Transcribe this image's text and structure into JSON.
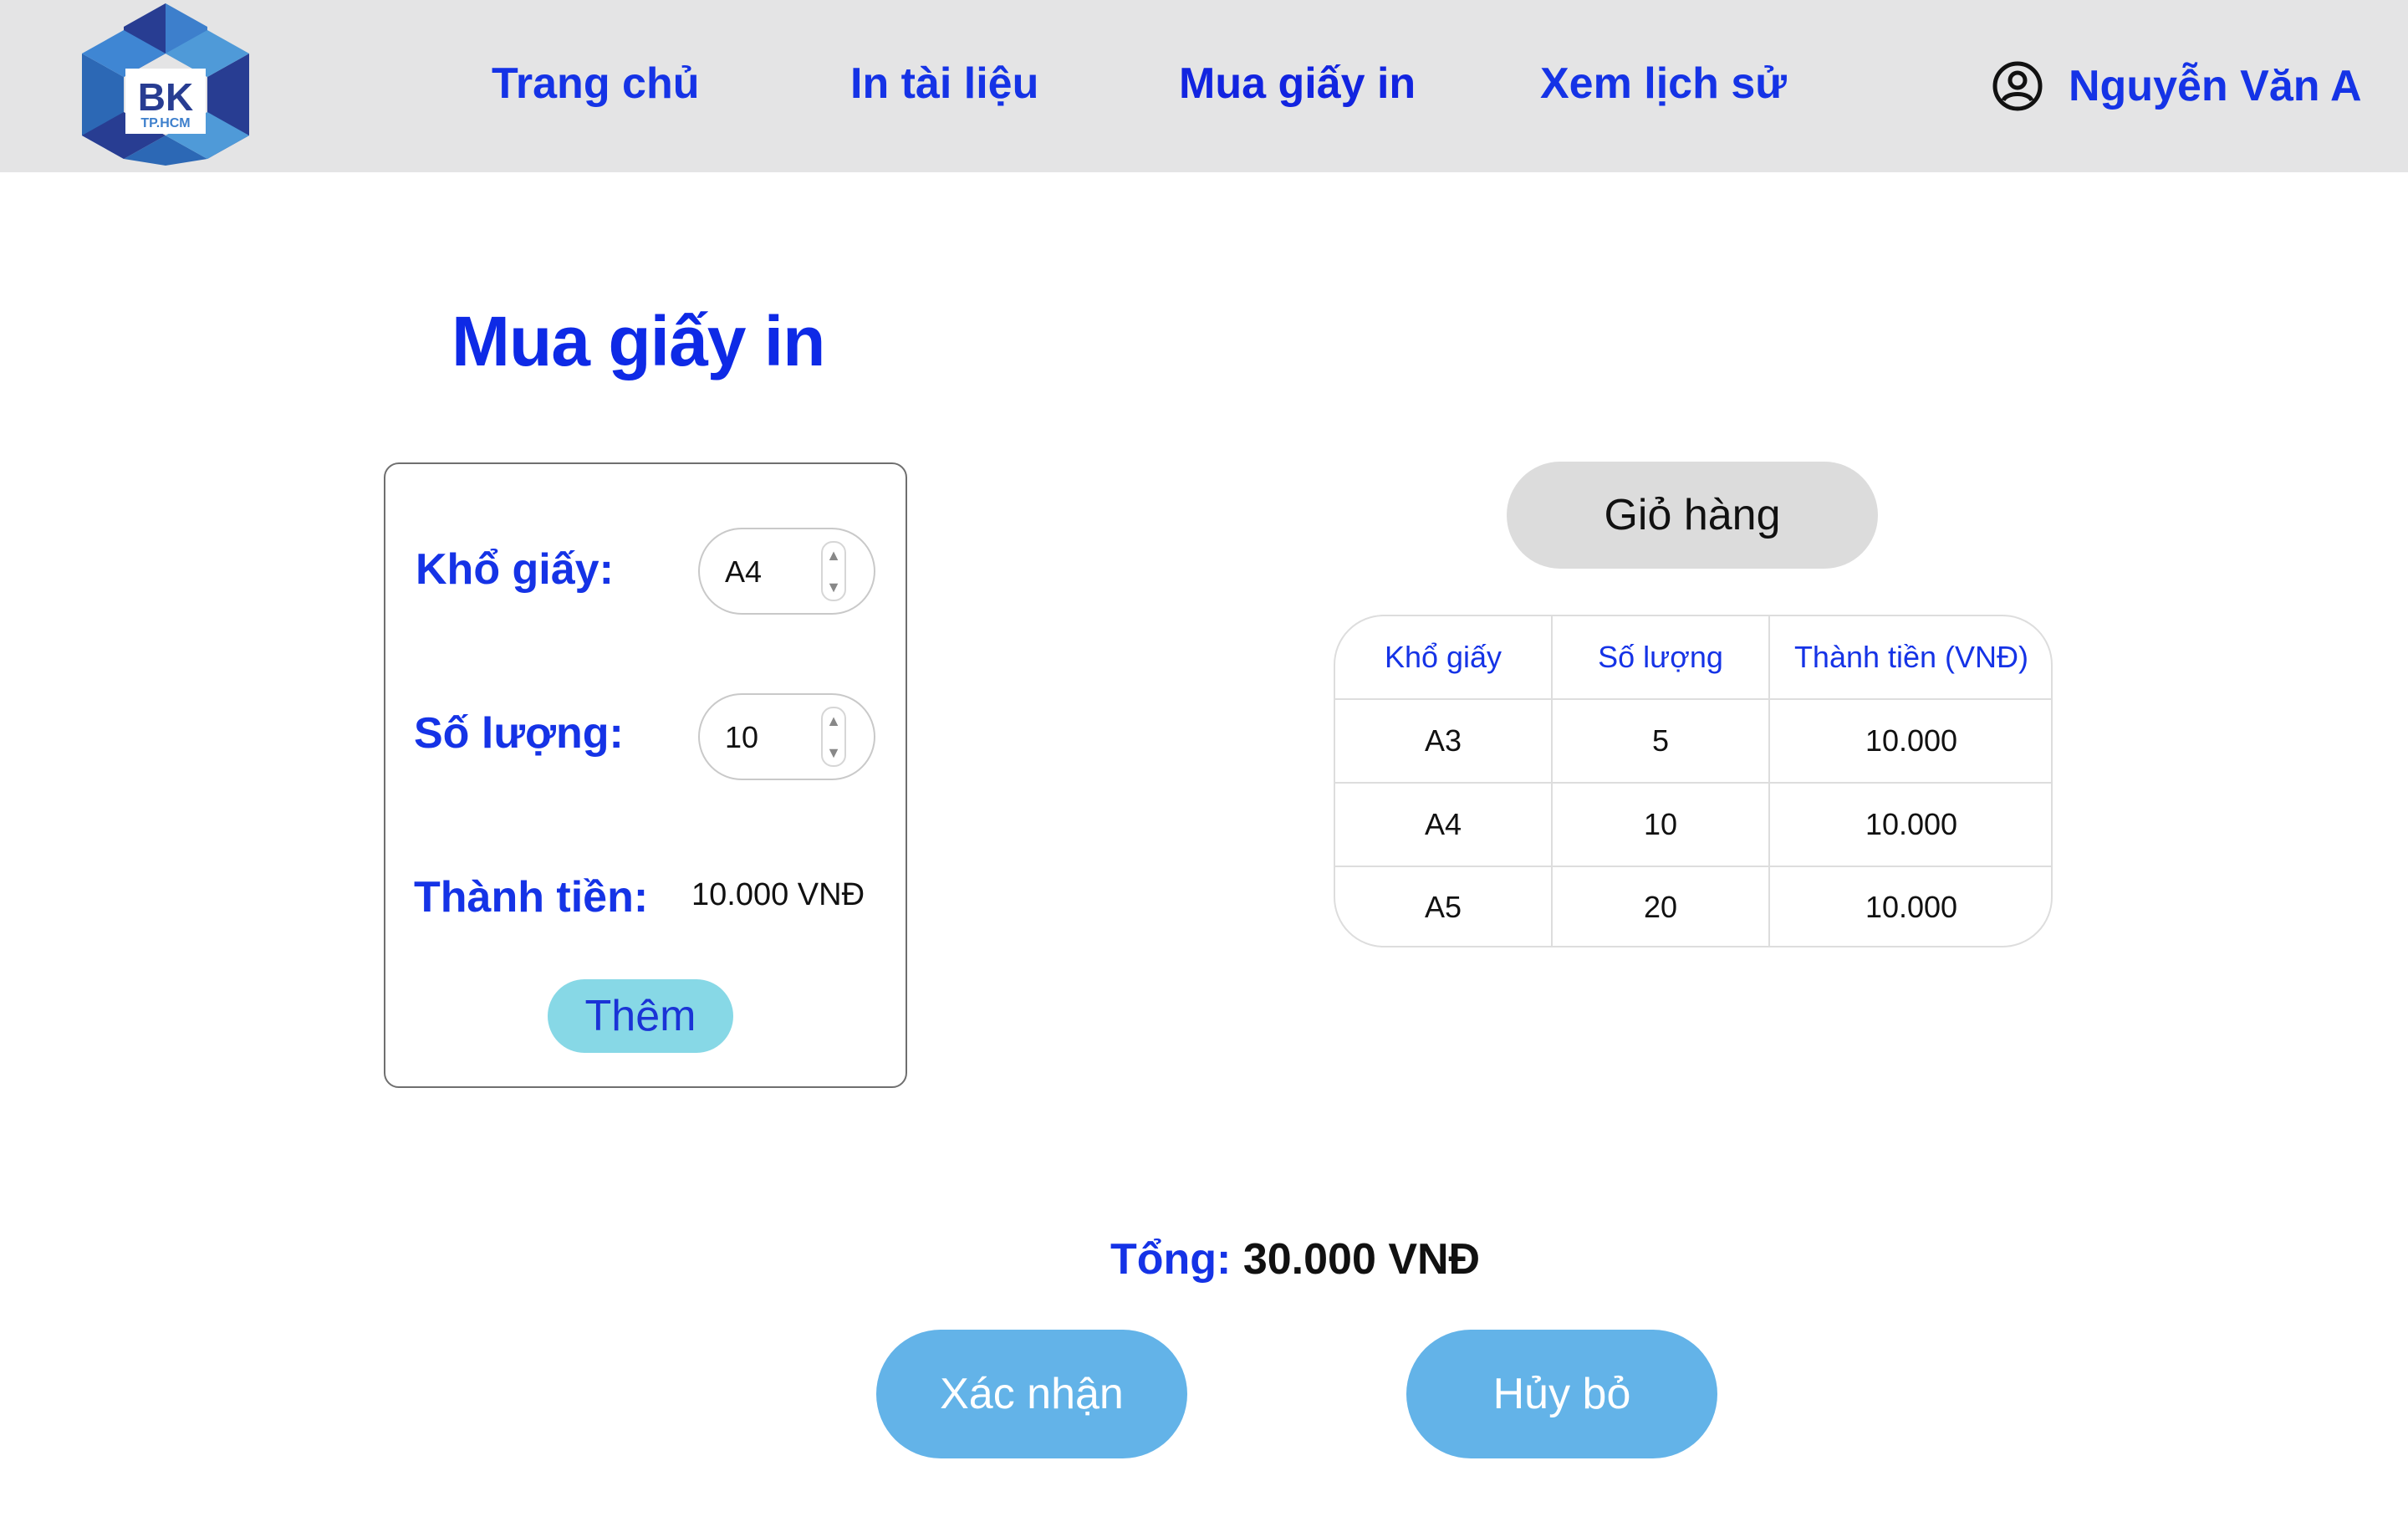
{
  "header": {
    "logo": {
      "text": "BK",
      "subtext": "TP.HCM",
      "colors": [
        "#2c68b5",
        "#283d92",
        "#4f9ad8"
      ]
    },
    "nav": [
      {
        "label": "Trang chủ",
        "active": false
      },
      {
        "label": "In tài liệu",
        "active": false
      },
      {
        "label": "Mua giấy in",
        "active": true
      },
      {
        "label": "Xem lịch sử",
        "active": false
      }
    ],
    "user": {
      "icon": "user-circle-icon",
      "name": "Nguyễn Văn A"
    }
  },
  "page": {
    "title": "Mua giấy in"
  },
  "form": {
    "paper_size_label": "Khổ giấy:",
    "paper_size_value": "A4",
    "quantity_label": "Số lượng:",
    "quantity_value": "10",
    "subtotal_label": "Thành tiền:",
    "subtotal_value": "10.000 VNĐ",
    "add_label": "Thêm"
  },
  "cart": {
    "title": "Giỏ hàng",
    "columns": [
      "Khổ giấy",
      "Số lượng",
      "Thành tiền (VNĐ)"
    ],
    "rows": [
      [
        "A3",
        "5",
        "10.000"
      ],
      [
        "A4",
        "10",
        "10.000"
      ],
      [
        "A5",
        "20",
        "10.000"
      ]
    ]
  },
  "summary": {
    "total_label": "Tổng:",
    "total_value": "30.000 VNĐ"
  },
  "actions": {
    "confirm_label": "Xác nhận",
    "cancel_label": "Hủy bỏ"
  },
  "colors": {
    "header_bg": "#e4e4e5",
    "primary_text": "#1533e6",
    "add_button": "#87d8e6",
    "action_button": "#63b3e8",
    "cart_badge": "#dcdcdc"
  }
}
